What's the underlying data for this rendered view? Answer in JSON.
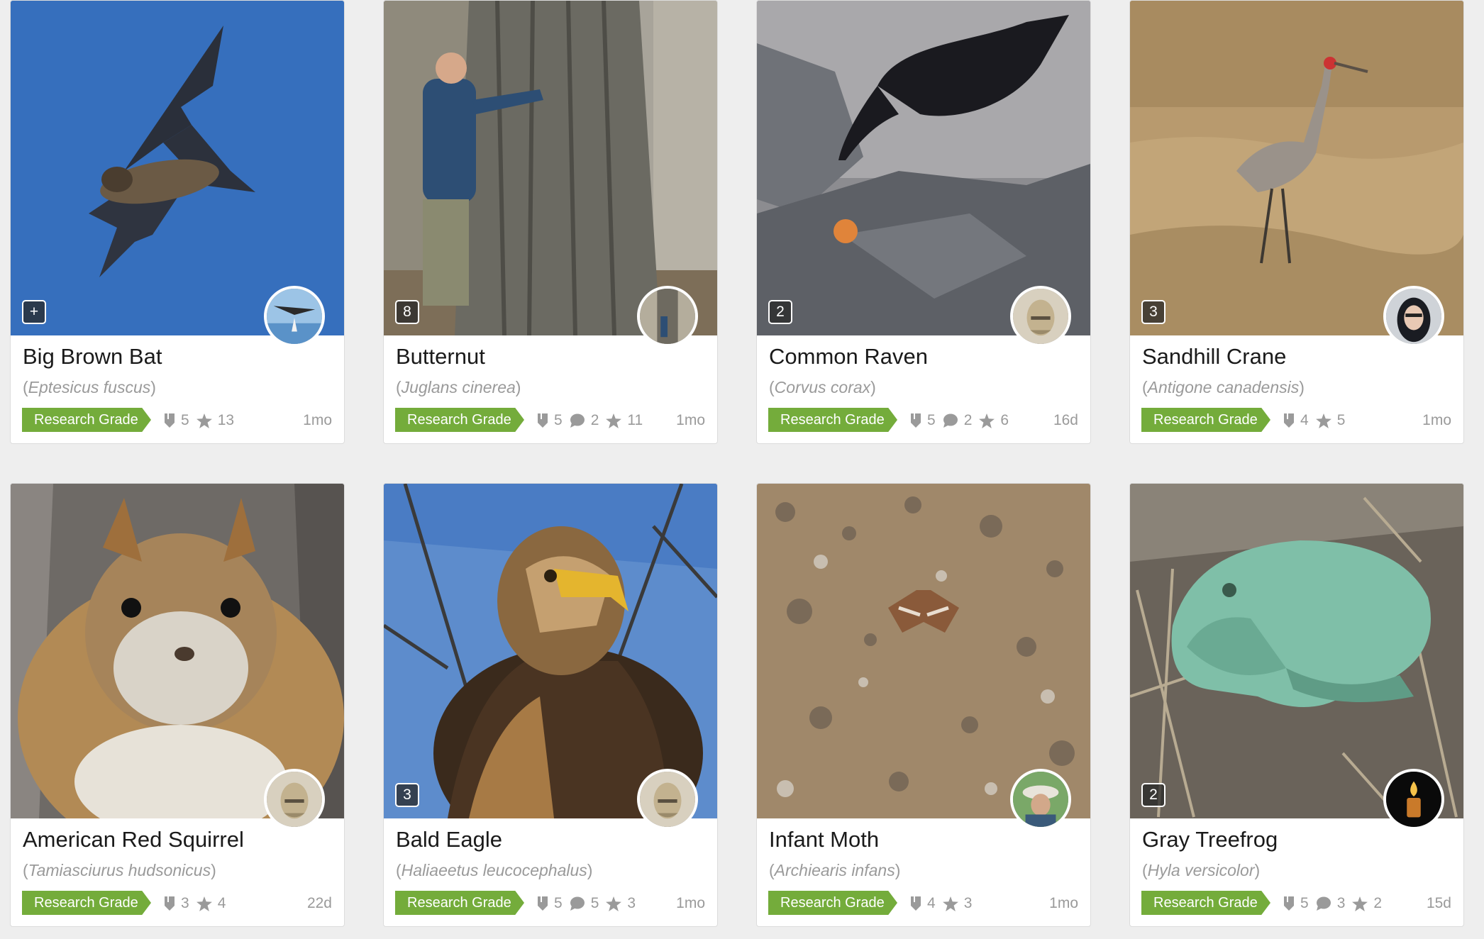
{
  "observations": [
    {
      "common": "Big Brown Bat",
      "open": "(",
      "scientific": "Eptesicus fuscus",
      "close": ")",
      "grade": "Research Grade",
      "ids": "5",
      "comments": null,
      "faves": "13",
      "time": "1mo",
      "photo_count": "+"
    },
    {
      "common": "Butternut",
      "open": "(",
      "scientific": "Juglans cinerea",
      "close": ")",
      "grade": "Research Grade",
      "ids": "5",
      "comments": "2",
      "faves": "11",
      "time": "1mo",
      "photo_count": "8"
    },
    {
      "common": "Common Raven",
      "open": "(",
      "scientific": "Corvus corax",
      "close": ")",
      "grade": "Research Grade",
      "ids": "5",
      "comments": "2",
      "faves": "6",
      "time": "16d",
      "photo_count": "2"
    },
    {
      "common": "Sandhill Crane",
      "open": "(",
      "scientific": "Antigone canadensis",
      "close": ")",
      "grade": "Research Grade",
      "ids": "4",
      "comments": null,
      "faves": "5",
      "time": "1mo",
      "photo_count": "3"
    },
    {
      "common": "American Red Squirrel",
      "open": "(",
      "scientific": "Tamiasciurus hudsonicus",
      "close": ")",
      "grade": "Research Grade",
      "ids": "3",
      "comments": null,
      "faves": "4",
      "time": "22d",
      "photo_count": null
    },
    {
      "common": "Bald Eagle",
      "open": "(",
      "scientific": "Haliaeetus leucocephalus",
      "close": ")",
      "grade": "Research Grade",
      "ids": "5",
      "comments": "5",
      "faves": "3",
      "time": "1mo",
      "photo_count": "3"
    },
    {
      "common": "Infant Moth",
      "open": "(",
      "scientific": "Archiearis infans",
      "close": ")",
      "grade": "Research Grade",
      "ids": "4",
      "comments": null,
      "faves": "3",
      "time": "1mo",
      "photo_count": null
    },
    {
      "common": "Gray Treefrog",
      "open": "(",
      "scientific": "Hyla versicolor",
      "close": ")",
      "grade": "Research Grade",
      "ids": "5",
      "comments": "3",
      "faves": "2",
      "time": "15d",
      "photo_count": "2"
    }
  ],
  "icons": {
    "ids": "identification-icon",
    "comments": "comment-icon",
    "faves": "star-icon"
  },
  "colors": {
    "research_grade": "#74ac3b",
    "meta_text": "#9a9a9a",
    "page_bg": "#eeeeee"
  }
}
